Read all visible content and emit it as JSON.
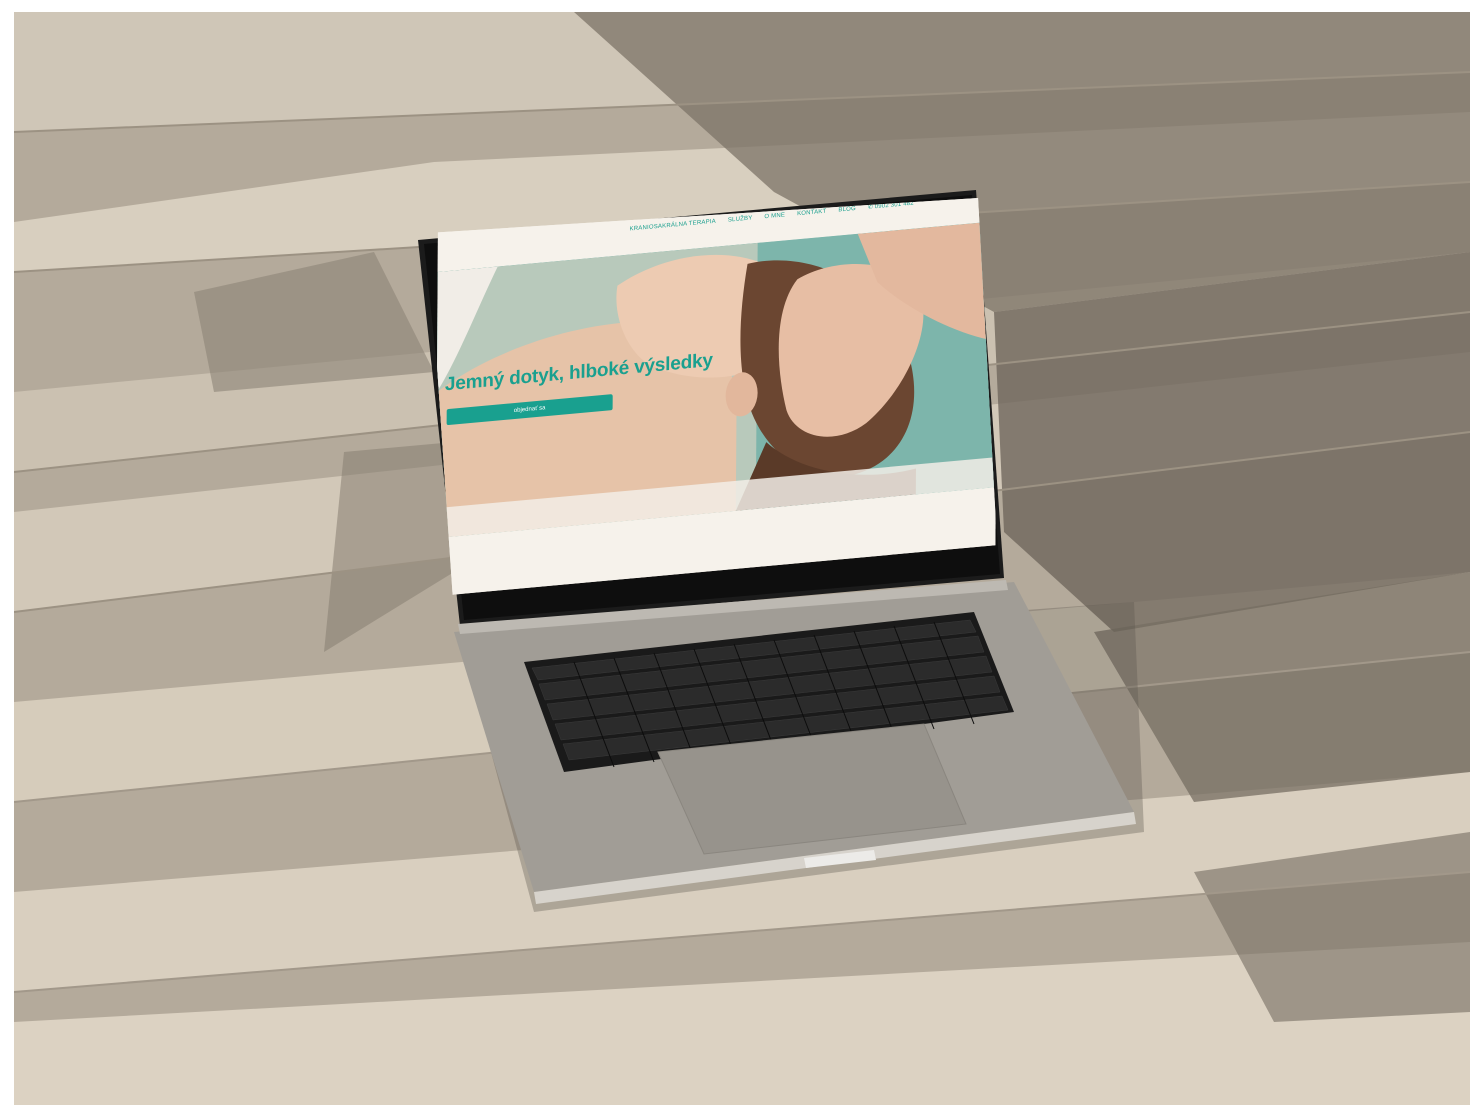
{
  "website": {
    "nav": {
      "items": [
        "KRANIOSAKRÁLNA TERAPIA",
        "SLUŽBY",
        "O MNE",
        "KONTAKT",
        "BLOG"
      ],
      "phone": "0902 301 482"
    },
    "hero": {
      "title": "Jemný dotyk, hlboké výsledky",
      "button_label": "objednať sa"
    }
  },
  "colors": {
    "accent": "#1aa08f",
    "page_background": "#f6f2eb",
    "laptop_body": "#9e9a93",
    "keyboard": "#151515"
  },
  "icons": {
    "phone": "phone-icon",
    "camera": "camera-notch"
  }
}
